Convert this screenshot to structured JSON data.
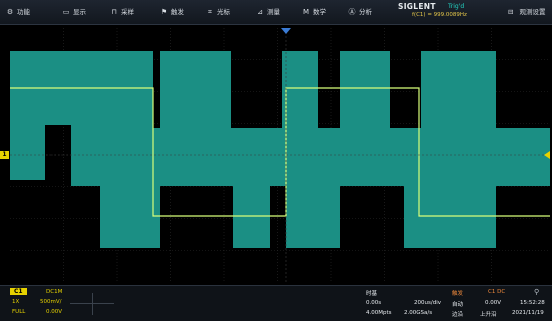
{
  "topbar": {
    "items": [
      {
        "icon": "gear-icon",
        "glyph": "⚙",
        "label": "功能"
      },
      {
        "icon": "monitor-icon",
        "glyph": "▭",
        "label": "显示"
      },
      {
        "icon": "acquire-icon",
        "glyph": "⊓",
        "label": "采样"
      },
      {
        "icon": "trigger-flag-icon",
        "glyph": "⚑",
        "label": "触发"
      },
      {
        "icon": "cursor-icon",
        "glyph": "⌗",
        "label": "光标"
      },
      {
        "icon": "measure-icon",
        "glyph": "⊿",
        "label": "测量"
      },
      {
        "icon": "math-icon",
        "glyph": "M",
        "label": "数学"
      },
      {
        "icon": "analysis-icon",
        "glyph": "Ⓐ",
        "label": "分析"
      }
    ],
    "brand": "SIGLENT",
    "trigger_state": "Trig'd",
    "frequency": "f(C1) = 999.0089Hz",
    "right_icon": "save-icon",
    "right_label": "观测设置"
  },
  "channel": {
    "name": "C1",
    "coupling": "DC1M",
    "probe": "1X",
    "scale": "500mV/",
    "bandwidth": "FULL",
    "offset": "0.00V"
  },
  "timebase": {
    "title": "时基",
    "delay": "0.00s",
    "scale": "200us/div",
    "memory": "4.00Mpts",
    "sample_rate": "2.00GSa/s"
  },
  "trigger": {
    "title": "触发",
    "source": "C1 DC",
    "mode": "自动",
    "level": "0.00V",
    "type": "边沿",
    "slope": "上升沿"
  },
  "clock": {
    "time": "15:52:28",
    "date": "2021/11/19",
    "usb_icon": "usb-icon"
  },
  "markers": {
    "channel_marker": "1"
  },
  "colors": {
    "trace": "#d8ff7a",
    "envelope": "#1b8f84",
    "channel": "#e6d200",
    "trigger_marker": "#3a7bd5"
  }
}
